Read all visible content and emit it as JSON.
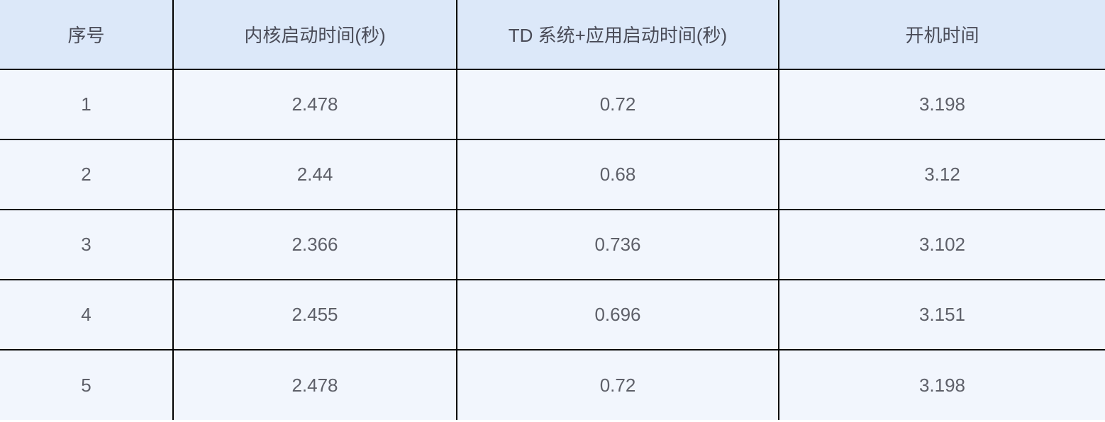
{
  "chart_data": {
    "type": "table",
    "columns": [
      "序号",
      "内核启动时间(秒)",
      "TD 系统+应用启动时间(秒)",
      "开机时间"
    ],
    "rows": [
      [
        "1",
        "2.478",
        "0.72",
        "3.198"
      ],
      [
        "2",
        "2.44",
        "0.68",
        "3.12"
      ],
      [
        "3",
        "2.366",
        "0.736",
        "3.102"
      ],
      [
        "4",
        "2.455",
        "0.696",
        "3.151"
      ],
      [
        "5",
        "2.478",
        "0.72",
        "3.198"
      ]
    ]
  }
}
